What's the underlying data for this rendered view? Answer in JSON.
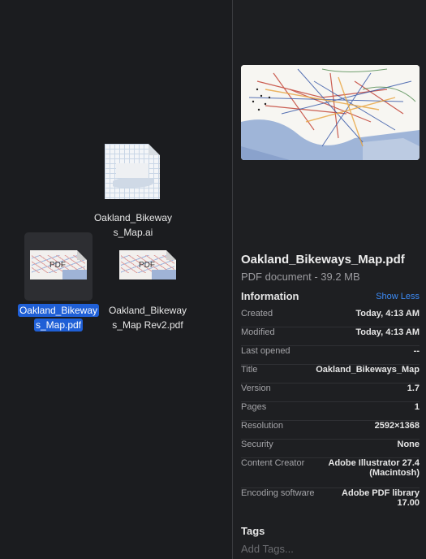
{
  "files": [
    {
      "name_line1": "Oakland_Bikeway",
      "name_line2": "s_Map.ai",
      "selected": false
    },
    {
      "name_line1": "Oakland_Bikeway",
      "name_line2": "s_Map.pdf",
      "selected": true,
      "thumb_label": "PDF"
    },
    {
      "name_line1": "Oakland_Bikeway",
      "name_line2": "s_Map Rev2.pdf",
      "selected": false,
      "thumb_label": "PDF"
    }
  ],
  "inspector": {
    "file_name": "Oakland_Bikeways_Map.pdf",
    "file_kind": "PDF document - 39.2 MB",
    "info_heading": "Information",
    "show_less": "Show Less",
    "rows": [
      {
        "key": "Created",
        "value": "Today, 4:13 AM"
      },
      {
        "key": "Modified",
        "value": "Today, 4:13 AM"
      },
      {
        "key": "Last opened",
        "value": "--"
      },
      {
        "key": "Title",
        "value": "Oakland_Bikeways_Map"
      },
      {
        "key": "Version",
        "value": "1.7"
      },
      {
        "key": "Pages",
        "value": "1"
      },
      {
        "key": "Resolution",
        "value": "2592×1368"
      },
      {
        "key": "Security",
        "value": "None"
      },
      {
        "key": "Content Creator",
        "value": "Adobe Illustrator 27.4",
        "value2": "(Macintosh)"
      },
      {
        "key": "Encoding software",
        "value": "Adobe PDF library",
        "value2": "17.00"
      }
    ],
    "tags_heading": "Tags",
    "tags_placeholder": "Add Tags..."
  },
  "colors": {
    "selection": "#1f5fd6",
    "link": "#3d8bf6",
    "background": "#1b1c1f"
  }
}
